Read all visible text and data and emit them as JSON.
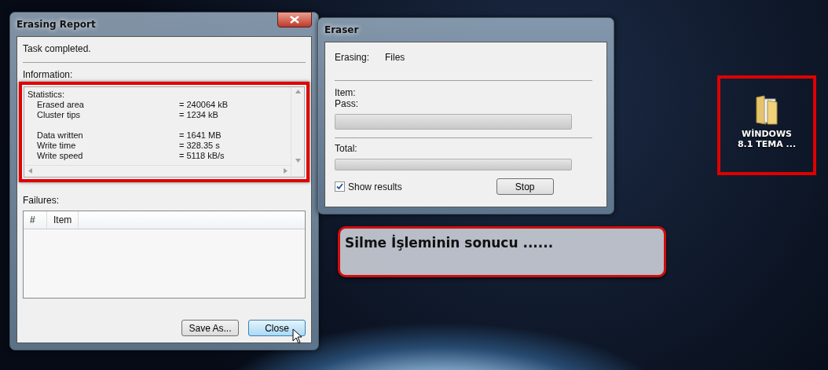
{
  "report_window": {
    "title": "Erasing Report",
    "status": "Task completed.",
    "information_label": "Information:",
    "statistics": {
      "heading": "Statistics:",
      "groups": [
        [
          {
            "label": "Erased area",
            "value": "= 240064 kB"
          },
          {
            "label": "Cluster tips",
            "value": "= 1234 kB"
          }
        ],
        [
          {
            "label": "Data written",
            "value": "= 1641 MB"
          },
          {
            "label": "Write time",
            "value": "= 328.35 s"
          },
          {
            "label": "Write speed",
            "value": "= 5118 kB/s"
          }
        ]
      ]
    },
    "failures_label": "Failures:",
    "failures_table": {
      "columns": [
        "#",
        "Item"
      ]
    },
    "buttons": [
      {
        "label": "Save As...",
        "focused": false
      },
      {
        "label": "Close",
        "focused": true
      }
    ]
  },
  "eraser_window": {
    "title": "Eraser",
    "erasing_label": "Erasing:",
    "erasing_value": "Files",
    "item_label": "Item:",
    "pass_label": "Pass:",
    "pass_progress": {
      "level": 0
    },
    "total_label": "Total:",
    "total_progress": {
      "level": 0
    },
    "show_results": {
      "label": "Show results",
      "checked": true
    },
    "stop_button": "Stop"
  },
  "callout": "Silme İşleminin sonucu ......",
  "desktop_icon": {
    "label": "WİNDOWS 8.1 TEMA ..."
  }
}
